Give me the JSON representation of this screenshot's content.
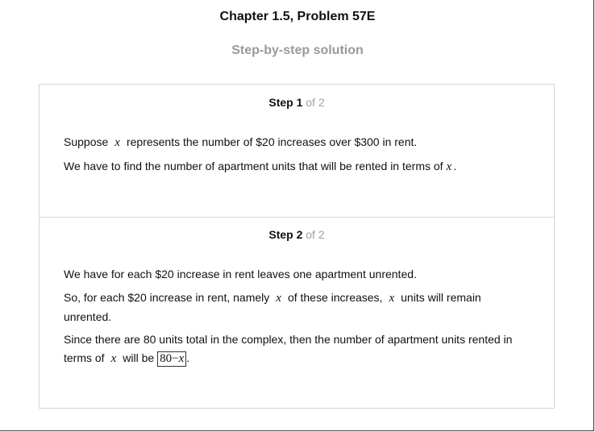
{
  "header": {
    "chapter_title": "Chapter 1.5, Problem 57E",
    "subtitle": "Step-by-step solution"
  },
  "steps": [
    {
      "label": "Step 1",
      "of": "of 2",
      "paragraphs": [
        {
          "before": "Suppose",
          "var": "x",
          "after": "represents the number of $20 increases over $300 in rent."
        },
        {
          "before": "We have to find the number of apartment units that will be rented in terms of",
          "var": "x",
          "after": "."
        }
      ]
    },
    {
      "label": "Step 2",
      "of": "of 2",
      "paragraphs": [
        {
          "text": "We have for each $20 increase in rent leaves one apartment unrented."
        },
        {
          "before": "So, for each $20 increase in rent, namely",
          "var1": "x",
          "middle": "of these increases,",
          "var2": "x",
          "after": "units will remain unrented."
        },
        {
          "before": "Since there are 80 units total in the complex, then the number of apartment units rented in terms of",
          "var": "x",
          "middle": "will be",
          "answer_num": "80",
          "answer_op": "−",
          "answer_var": "x",
          "after": "."
        }
      ]
    }
  ]
}
